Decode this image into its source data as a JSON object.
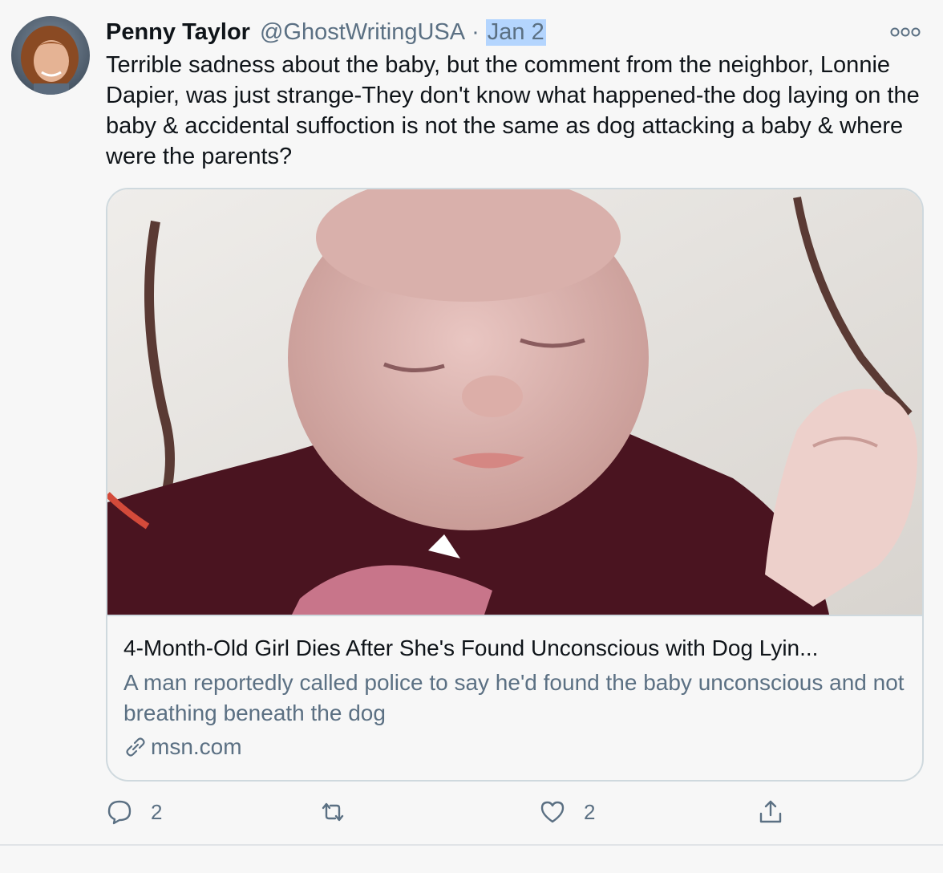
{
  "tweet": {
    "author_name": "Penny Taylor",
    "author_handle": "@GhostWritingUSA",
    "separator": "·",
    "date": "Jan 2",
    "text": "Terrible sadness about the baby, but the comment from the neighbor, Lonnie Dapier, was just strange-They don't know what happened-the dog laying on the baby & accidental suffoction is not the same as dog attacking a baby & where were the parents?"
  },
  "card": {
    "title": "4-Month-Old Girl Dies After She's Found Unconscious with Dog Lyin...",
    "description": "A man reportedly called police to say he'd found the baby unconscious and not breathing beneath the dog",
    "domain": "msn.com"
  },
  "actions": {
    "reply_count": "2",
    "retweet_count": "",
    "like_count": "2"
  },
  "icons": {
    "more": "more-icon",
    "reply": "reply-icon",
    "retweet": "retweet-icon",
    "like": "like-icon",
    "share": "share-icon",
    "link": "link-icon"
  },
  "colors": {
    "secondary_text": "#5b7083",
    "date_highlight": "#b4d5fe",
    "card_border": "#cfd9de"
  }
}
